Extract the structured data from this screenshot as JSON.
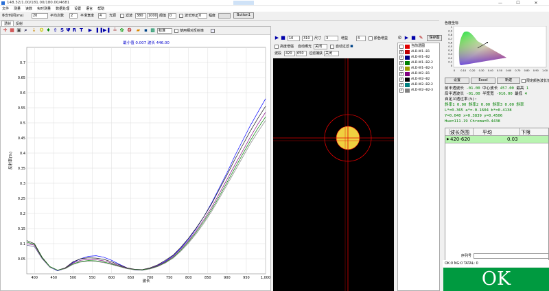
{
  "window": {
    "title": "148.32/1.00/181.00/180.00/4681",
    "min": "—",
    "max": "☐",
    "close": "✕"
  },
  "menu": [
    "文件",
    "测量",
    "读数",
    "实时测量",
    "数据处理",
    "设置",
    "语言",
    "帮助"
  ],
  "toolbar": {
    "integ_label": "积分时间(ms)",
    "integ_value": "20",
    "avg_label": "平均次数",
    "avg_value": "2",
    "smooth_label": "平滑宽度",
    "smooth_value": "4",
    "light_label": "光源",
    "filter_label": "滤波",
    "range_from": "380",
    "range_to": "1000",
    "threshold_label": "阈值",
    "threshold_value": "0",
    "wl_corr_label": "波长矫正",
    "wl_corr_value": "0",
    "gain_label": "幅度",
    "button1": "Button1"
  },
  "tabs": [
    "透射",
    "反射"
  ],
  "chart_toolbar": {
    "standard_label": "标准",
    "cb_label": "使用相对反射率"
  },
  "chart_data": {
    "type": "line",
    "title": "最小值 0.007 波长 446.00",
    "xlabel": "波长",
    "ylabel": "反射率(%)",
    "xlim": [
      380,
      1000
    ],
    "ylim": [
      0,
      0.75
    ],
    "xticks": [
      "400",
      "450",
      "500",
      "550",
      "600",
      "650",
      "700",
      "750",
      "800",
      "850",
      "900",
      "950",
      "1,000"
    ],
    "yticks": [
      "0.05",
      "0.1",
      "0.15",
      "0.2",
      "0.25",
      "0.3",
      "0.35",
      "0.4",
      "0.45",
      "0.5",
      "0.55",
      "0.6",
      "0.65",
      "0.7"
    ],
    "series": [
      {
        "color": "#0000ff",
        "x": [
          380,
          400,
          420,
          440,
          460,
          480,
          500,
          520,
          540,
          560,
          580,
          600,
          620,
          640,
          660,
          680,
          700,
          720,
          740,
          760,
          780,
          800,
          820,
          840,
          860,
          880,
          900,
          920,
          940,
          960,
          980,
          1000
        ],
        "values": [
          0.095,
          0.09,
          0.05,
          0.022,
          0.01,
          0.018,
          0.038,
          0.05,
          0.058,
          0.06,
          0.055,
          0.045,
          0.032,
          0.02,
          0.013,
          0.012,
          0.018,
          0.028,
          0.042,
          0.06,
          0.085,
          0.115,
          0.15,
          0.19,
          0.235,
          0.285,
          0.335,
          0.39,
          0.44,
          0.49,
          0.535,
          0.58
        ]
      },
      {
        "color": "#1a1a1a",
        "x": [
          380,
          400,
          420,
          440,
          460,
          480,
          500,
          520,
          540,
          560,
          580,
          600,
          620,
          640,
          660,
          680,
          700,
          720,
          740,
          760,
          780,
          800,
          820,
          840,
          860,
          880,
          900,
          920,
          940,
          960,
          980,
          1000
        ],
        "values": [
          0.11,
          0.1,
          0.055,
          0.024,
          0.012,
          0.02,
          0.04,
          0.05,
          0.053,
          0.052,
          0.048,
          0.04,
          0.03,
          0.02,
          0.015,
          0.014,
          0.02,
          0.03,
          0.045,
          0.062,
          0.088,
          0.118,
          0.152,
          0.19,
          0.232,
          0.28,
          0.328,
          0.378,
          0.425,
          0.472,
          0.515,
          0.555
        ]
      },
      {
        "color": "#800080",
        "x": [
          380,
          400,
          420,
          440,
          460,
          480,
          500,
          520,
          540,
          560,
          580,
          600,
          620,
          640,
          660,
          680,
          700,
          720,
          740,
          760,
          780,
          800,
          820,
          840,
          860,
          880,
          900,
          920,
          940,
          960,
          980,
          1000
        ],
        "values": [
          0.1,
          0.095,
          0.052,
          0.023,
          0.011,
          0.019,
          0.036,
          0.045,
          0.048,
          0.047,
          0.043,
          0.036,
          0.027,
          0.019,
          0.014,
          0.013,
          0.018,
          0.027,
          0.04,
          0.057,
          0.082,
          0.11,
          0.143,
          0.18,
          0.22,
          0.266,
          0.313,
          0.36,
          0.406,
          0.452,
          0.496,
          0.535
        ]
      },
      {
        "color": "#008000",
        "x": [
          380,
          400,
          420,
          440,
          460,
          480,
          500,
          520,
          540,
          560,
          580,
          600,
          620,
          640,
          660,
          680,
          700,
          720,
          740,
          760,
          780,
          800,
          820,
          840,
          860,
          880,
          900,
          920,
          940,
          960,
          980,
          1000
        ],
        "values": [
          0.105,
          0.098,
          0.054,
          0.024,
          0.012,
          0.018,
          0.033,
          0.041,
          0.044,
          0.043,
          0.039,
          0.033,
          0.025,
          0.018,
          0.014,
          0.013,
          0.017,
          0.025,
          0.038,
          0.054,
          0.078,
          0.106,
          0.138,
          0.174,
          0.213,
          0.257,
          0.303,
          0.349,
          0.395,
          0.44,
          0.482,
          0.52
        ]
      },
      {
        "color": "#808080",
        "x": [
          380,
          400,
          420,
          440,
          460,
          480,
          500,
          520,
          540,
          560,
          580,
          600,
          620,
          640,
          660,
          680,
          700,
          720,
          740,
          760,
          780,
          800,
          820,
          840,
          860,
          880,
          900,
          920,
          940,
          960,
          980,
          1000
        ],
        "values": [
          0.095,
          0.09,
          0.05,
          0.022,
          0.011,
          0.017,
          0.031,
          0.039,
          0.042,
          0.041,
          0.037,
          0.031,
          0.024,
          0.017,
          0.013,
          0.012,
          0.016,
          0.024,
          0.036,
          0.052,
          0.075,
          0.102,
          0.133,
          0.168,
          0.207,
          0.25,
          0.295,
          0.34,
          0.385,
          0.43,
          0.47,
          0.508
        ]
      }
    ]
  },
  "camera": {
    "val1": "10",
    "val2": "310",
    "size_label": "尺寸",
    "size_value": "3",
    "gain_label": "增益",
    "gain_value": "4",
    "color_gain_label": "颜色增益",
    "hdr_label": "高度增强",
    "auto_exposure_label": "自动曝光",
    "auto_exposure_value": "关闭",
    "auto_filter_label": "自动过滤",
    "wl_label": "波段",
    "wl_from": "420",
    "wl_to": "650",
    "filter_label": "过滤捕获",
    "filter_value": "关闭"
  },
  "samples": {
    "header": "当前透图",
    "items": [
      {
        "label": "ALD-W1--B1",
        "color": "#c00000"
      },
      {
        "label": "ALD-W1--B2",
        "color": "#000080"
      },
      {
        "label": "ALD-W1--B2-2",
        "color": "#008000"
      },
      {
        "label": "ALD-W1--B2-3",
        "color": "#a0a000"
      },
      {
        "label": "ALD-W2--B1",
        "color": "#800080"
      },
      {
        "label": "ALD-W2--B2",
        "color": "#000000"
      },
      {
        "label": "ALD-W2--B2-2",
        "color": "#008080"
      },
      {
        "label": "ALD-W2--B2-3",
        "color": "#808080"
      }
    ],
    "save_btn": "保存图"
  },
  "right": {
    "cie_title": "色度坐标",
    "cie_yticks": [
      "1",
      "0.9",
      "0.8",
      "0.7",
      "0.6",
      "0.5",
      "0.4",
      "0.3",
      "0.2",
      "0.1",
      "0"
    ],
    "cie_xticks": [
      "0",
      "0.10",
      "0.20",
      "0.30",
      "0.40",
      "0.50",
      "0.60",
      "0.70",
      "0.80",
      "0.90",
      "1.00"
    ],
    "btn_settings": "设置",
    "btn_excel": "Excel",
    "btn_add": "新建",
    "cb_label": "限定颜色波长范围",
    "l1a": "前半透波长",
    "l1b": "-01.00",
    "l1c": "中心波长",
    "l1d": "457.00",
    "l1e": "最高",
    "l1f": "1",
    "l2a": "后半透波长",
    "l2b": "-01.00",
    "l2c": "半宽宽",
    "l2d": "-916.00",
    "l2e": "最低",
    "l2f": "4",
    "custom": "自定义透过率(%):",
    "slope1": "斜率1 0.00",
    "slope2": "斜率2 0.00",
    "slope3": "斜率3 0.00",
    "slope4": "斜率",
    "lab1": "L*=0.365 a*=-0.1604 b*=0.4138",
    "lab2": "Y=0.040 x=0.3839 y=0.4506",
    "lab3": "Hue=111.19 Chroma=0.4438",
    "table_headers": [
      "波长范围",
      "平均",
      "下限"
    ],
    "table_row": [
      "420-620",
      "0.03",
      ""
    ],
    "serial_label": "序列号",
    "status": "OK:0 NG:0 TATAL: 0",
    "result": "OK"
  }
}
